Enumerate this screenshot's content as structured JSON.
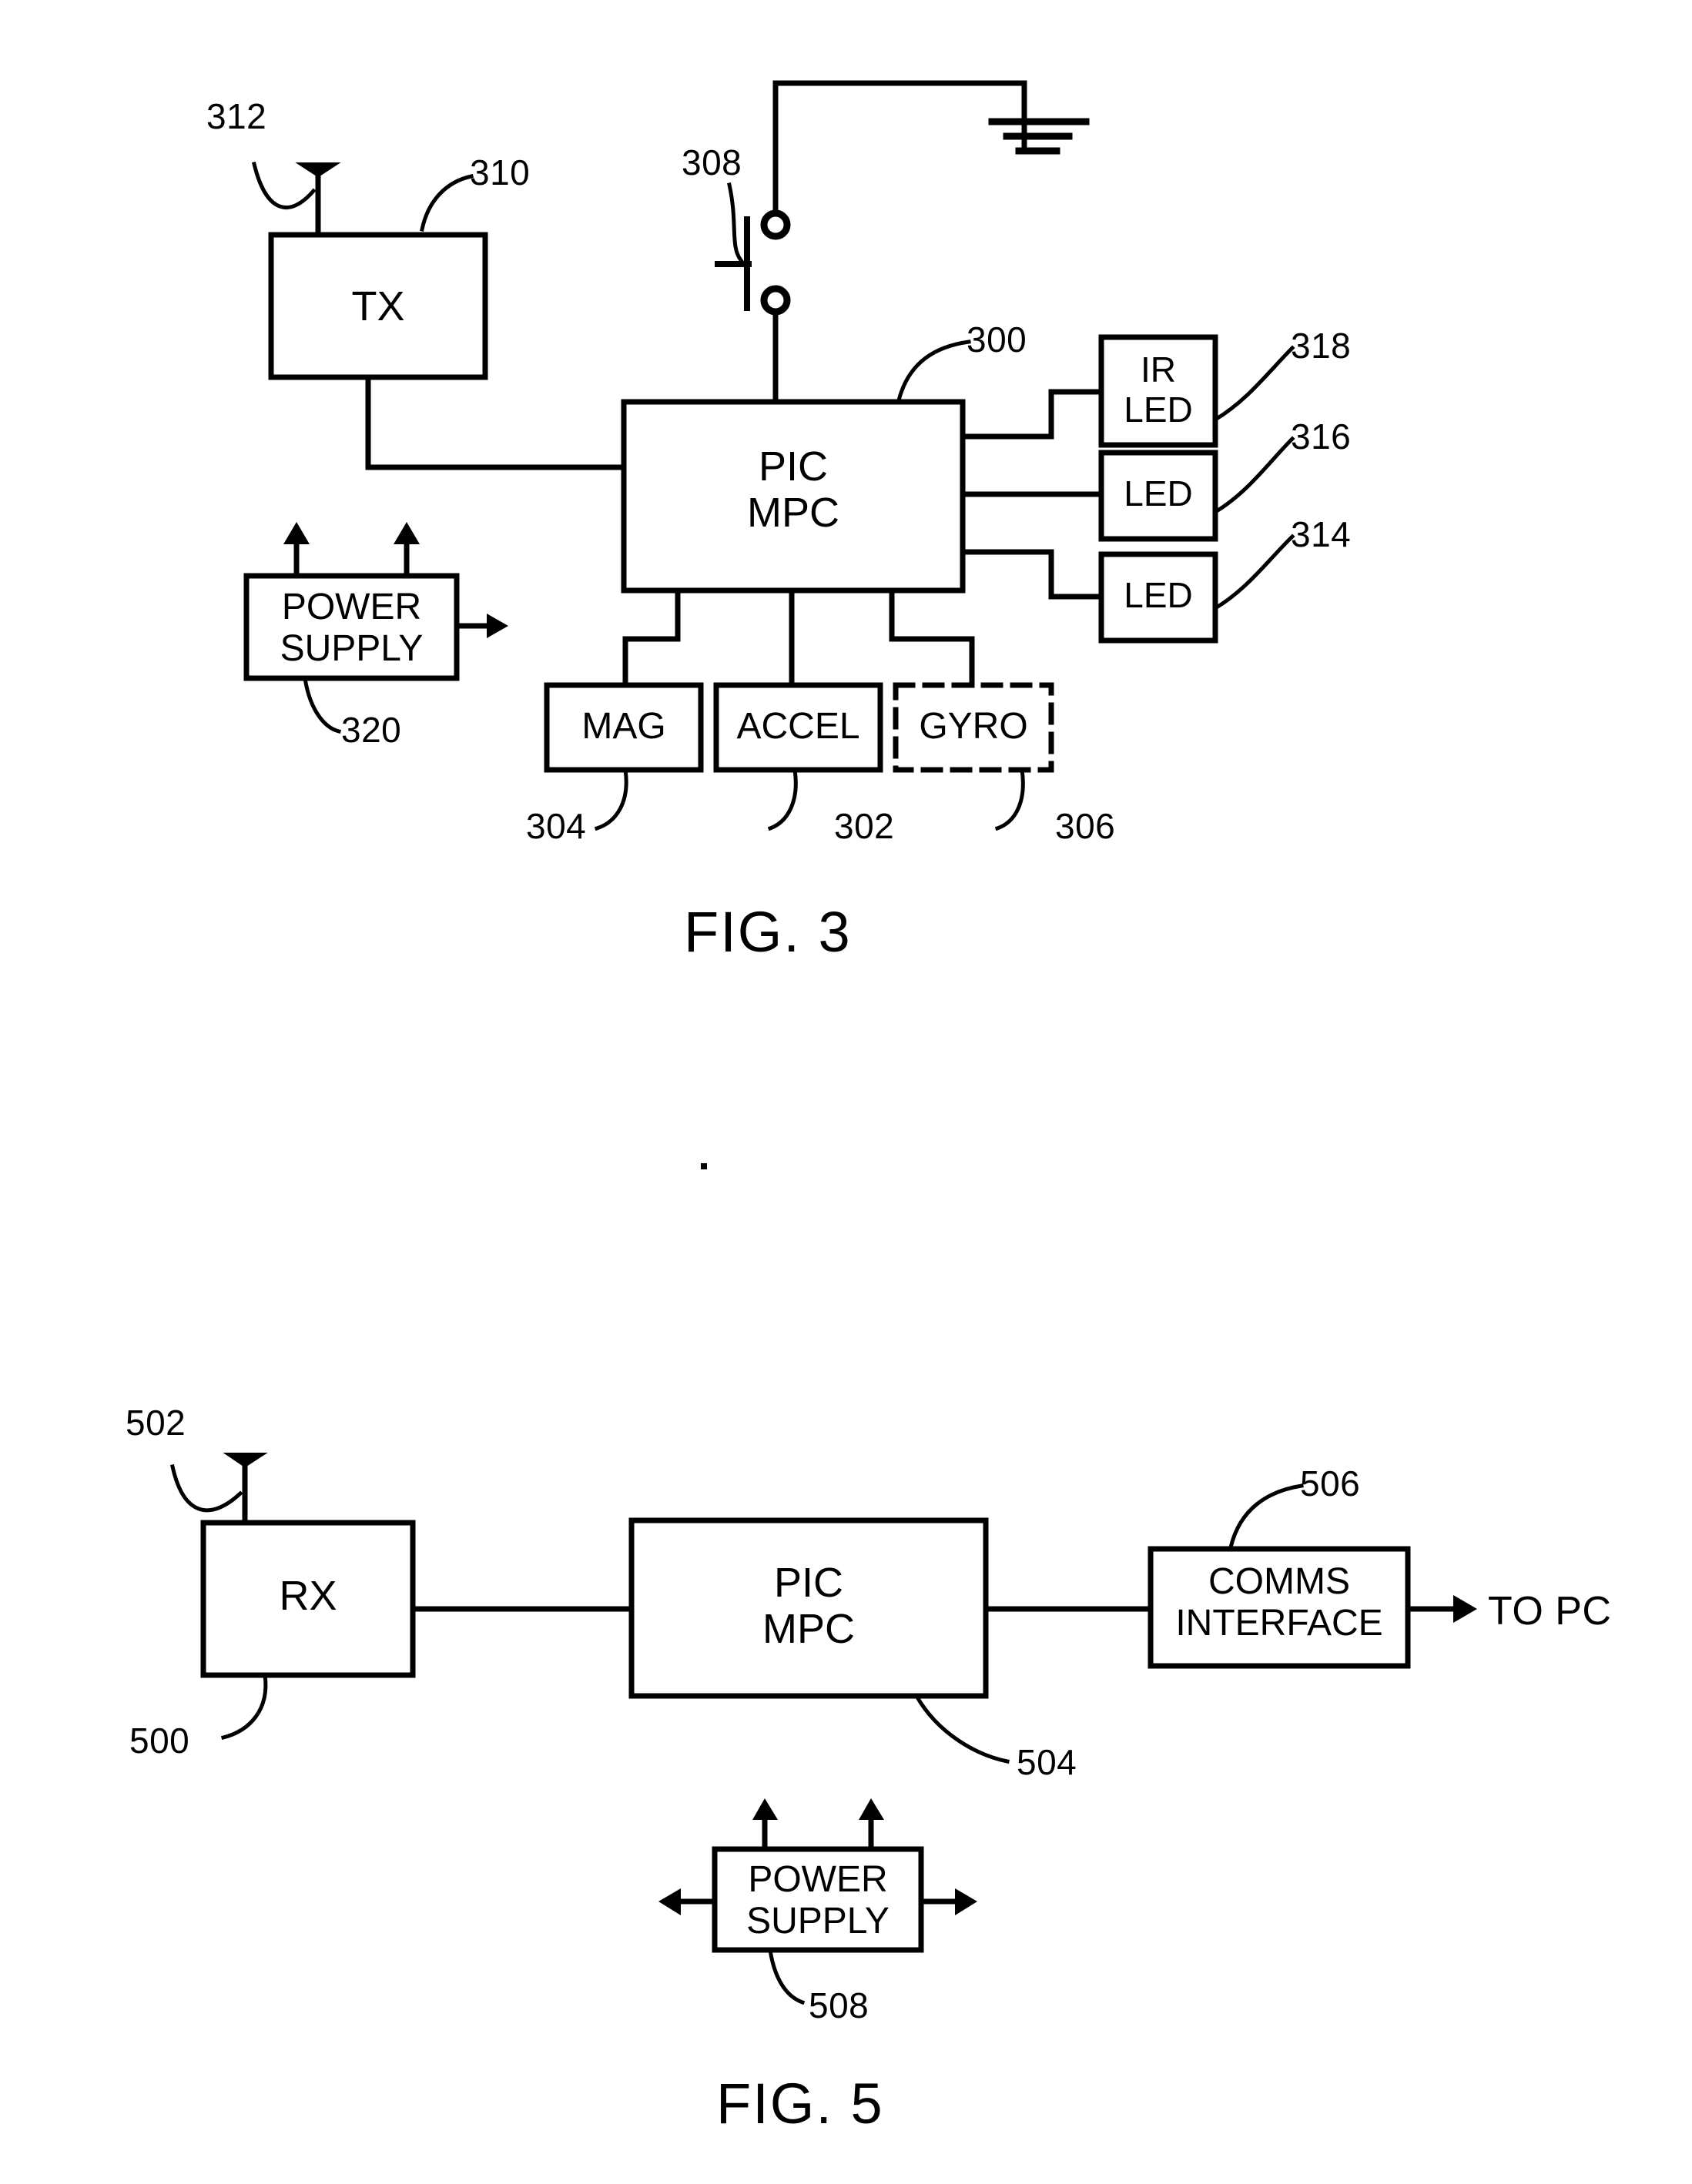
{
  "sheet": {
    "background_color": "#ffffff",
    "ink_color": "#000000"
  },
  "figures": [
    {
      "id": "fig3",
      "caption": "FIG. 3",
      "blocks": [
        {
          "key": "tx",
          "label": "TX",
          "ref": "310",
          "border": "solid"
        },
        {
          "key": "pic_mpc",
          "label": "PIC\nMPC",
          "ref": "300",
          "border": "solid"
        },
        {
          "key": "ir_led",
          "label": "IR\nLED",
          "ref": "318",
          "border": "solid"
        },
        {
          "key": "led_316",
          "label": "LED",
          "ref": "316",
          "border": "solid"
        },
        {
          "key": "led_314",
          "label": "LED",
          "ref": "314",
          "border": "solid"
        },
        {
          "key": "power_supply",
          "label": "POWER\nSUPPLY",
          "ref": "320",
          "border": "solid"
        },
        {
          "key": "mag",
          "label": "MAG",
          "ref": "304",
          "border": "solid"
        },
        {
          "key": "accel",
          "label": "ACCEL",
          "ref": "302",
          "border": "solid"
        },
        {
          "key": "gyro",
          "label": "GYRO",
          "ref": "306",
          "border": "dashed"
        }
      ],
      "symbols": [
        {
          "key": "antenna",
          "name": "antenna-symbol",
          "ref": "312"
        },
        {
          "key": "switch",
          "name": "pushbutton-switch-symbol",
          "ref": "308"
        },
        {
          "key": "ground",
          "name": "ground-symbol",
          "ref": ""
        }
      ],
      "ref_labels": [
        "312",
        "310",
        "308",
        "300",
        "318",
        "316",
        "314",
        "320",
        "304",
        "302",
        "306"
      ]
    },
    {
      "id": "fig5",
      "caption": "FIG. 5",
      "blocks": [
        {
          "key": "rx",
          "label": "RX",
          "ref": "500",
          "border": "solid"
        },
        {
          "key": "pic_mpc",
          "label": "PIC\nMPC",
          "ref": "504",
          "border": "solid"
        },
        {
          "key": "comms",
          "label": "COMMS\nINTERFACE",
          "ref": "506",
          "border": "solid"
        },
        {
          "key": "power_supply",
          "label": "POWER\nSUPPLY",
          "ref": "508",
          "border": "solid"
        }
      ],
      "symbols": [
        {
          "key": "antenna",
          "name": "antenna-symbol",
          "ref": "502"
        }
      ],
      "annotations": [
        {
          "key": "to_pc",
          "label": "TO PC"
        }
      ],
      "ref_labels": [
        "502",
        "500",
        "504",
        "506",
        "508"
      ]
    }
  ],
  "text": {
    "fig3": {
      "caption": "FIG. 3",
      "tx": "TX",
      "pic_mpc": "PIC\nMPC",
      "ir_led": "IR\nLED",
      "led_316": "LED",
      "led_314": "LED",
      "power_supply": "POWER\nSUPPLY",
      "mag": "MAG",
      "accel": "ACCEL",
      "gyro": "GYRO",
      "ref_312": "312",
      "ref_310": "310",
      "ref_308": "308",
      "ref_300": "300",
      "ref_318": "318",
      "ref_316": "316",
      "ref_314": "314",
      "ref_320": "320",
      "ref_304": "304",
      "ref_302": "302",
      "ref_306": "306"
    },
    "fig5": {
      "caption": "FIG. 5",
      "rx": "RX",
      "pic_mpc": "PIC\nMPC",
      "comms": "COMMS\nINTERFACE",
      "power_supply": "POWER\nSUPPLY",
      "to_pc": "TO PC",
      "ref_502": "502",
      "ref_500": "500",
      "ref_504": "504",
      "ref_506": "506",
      "ref_508": "508"
    }
  }
}
